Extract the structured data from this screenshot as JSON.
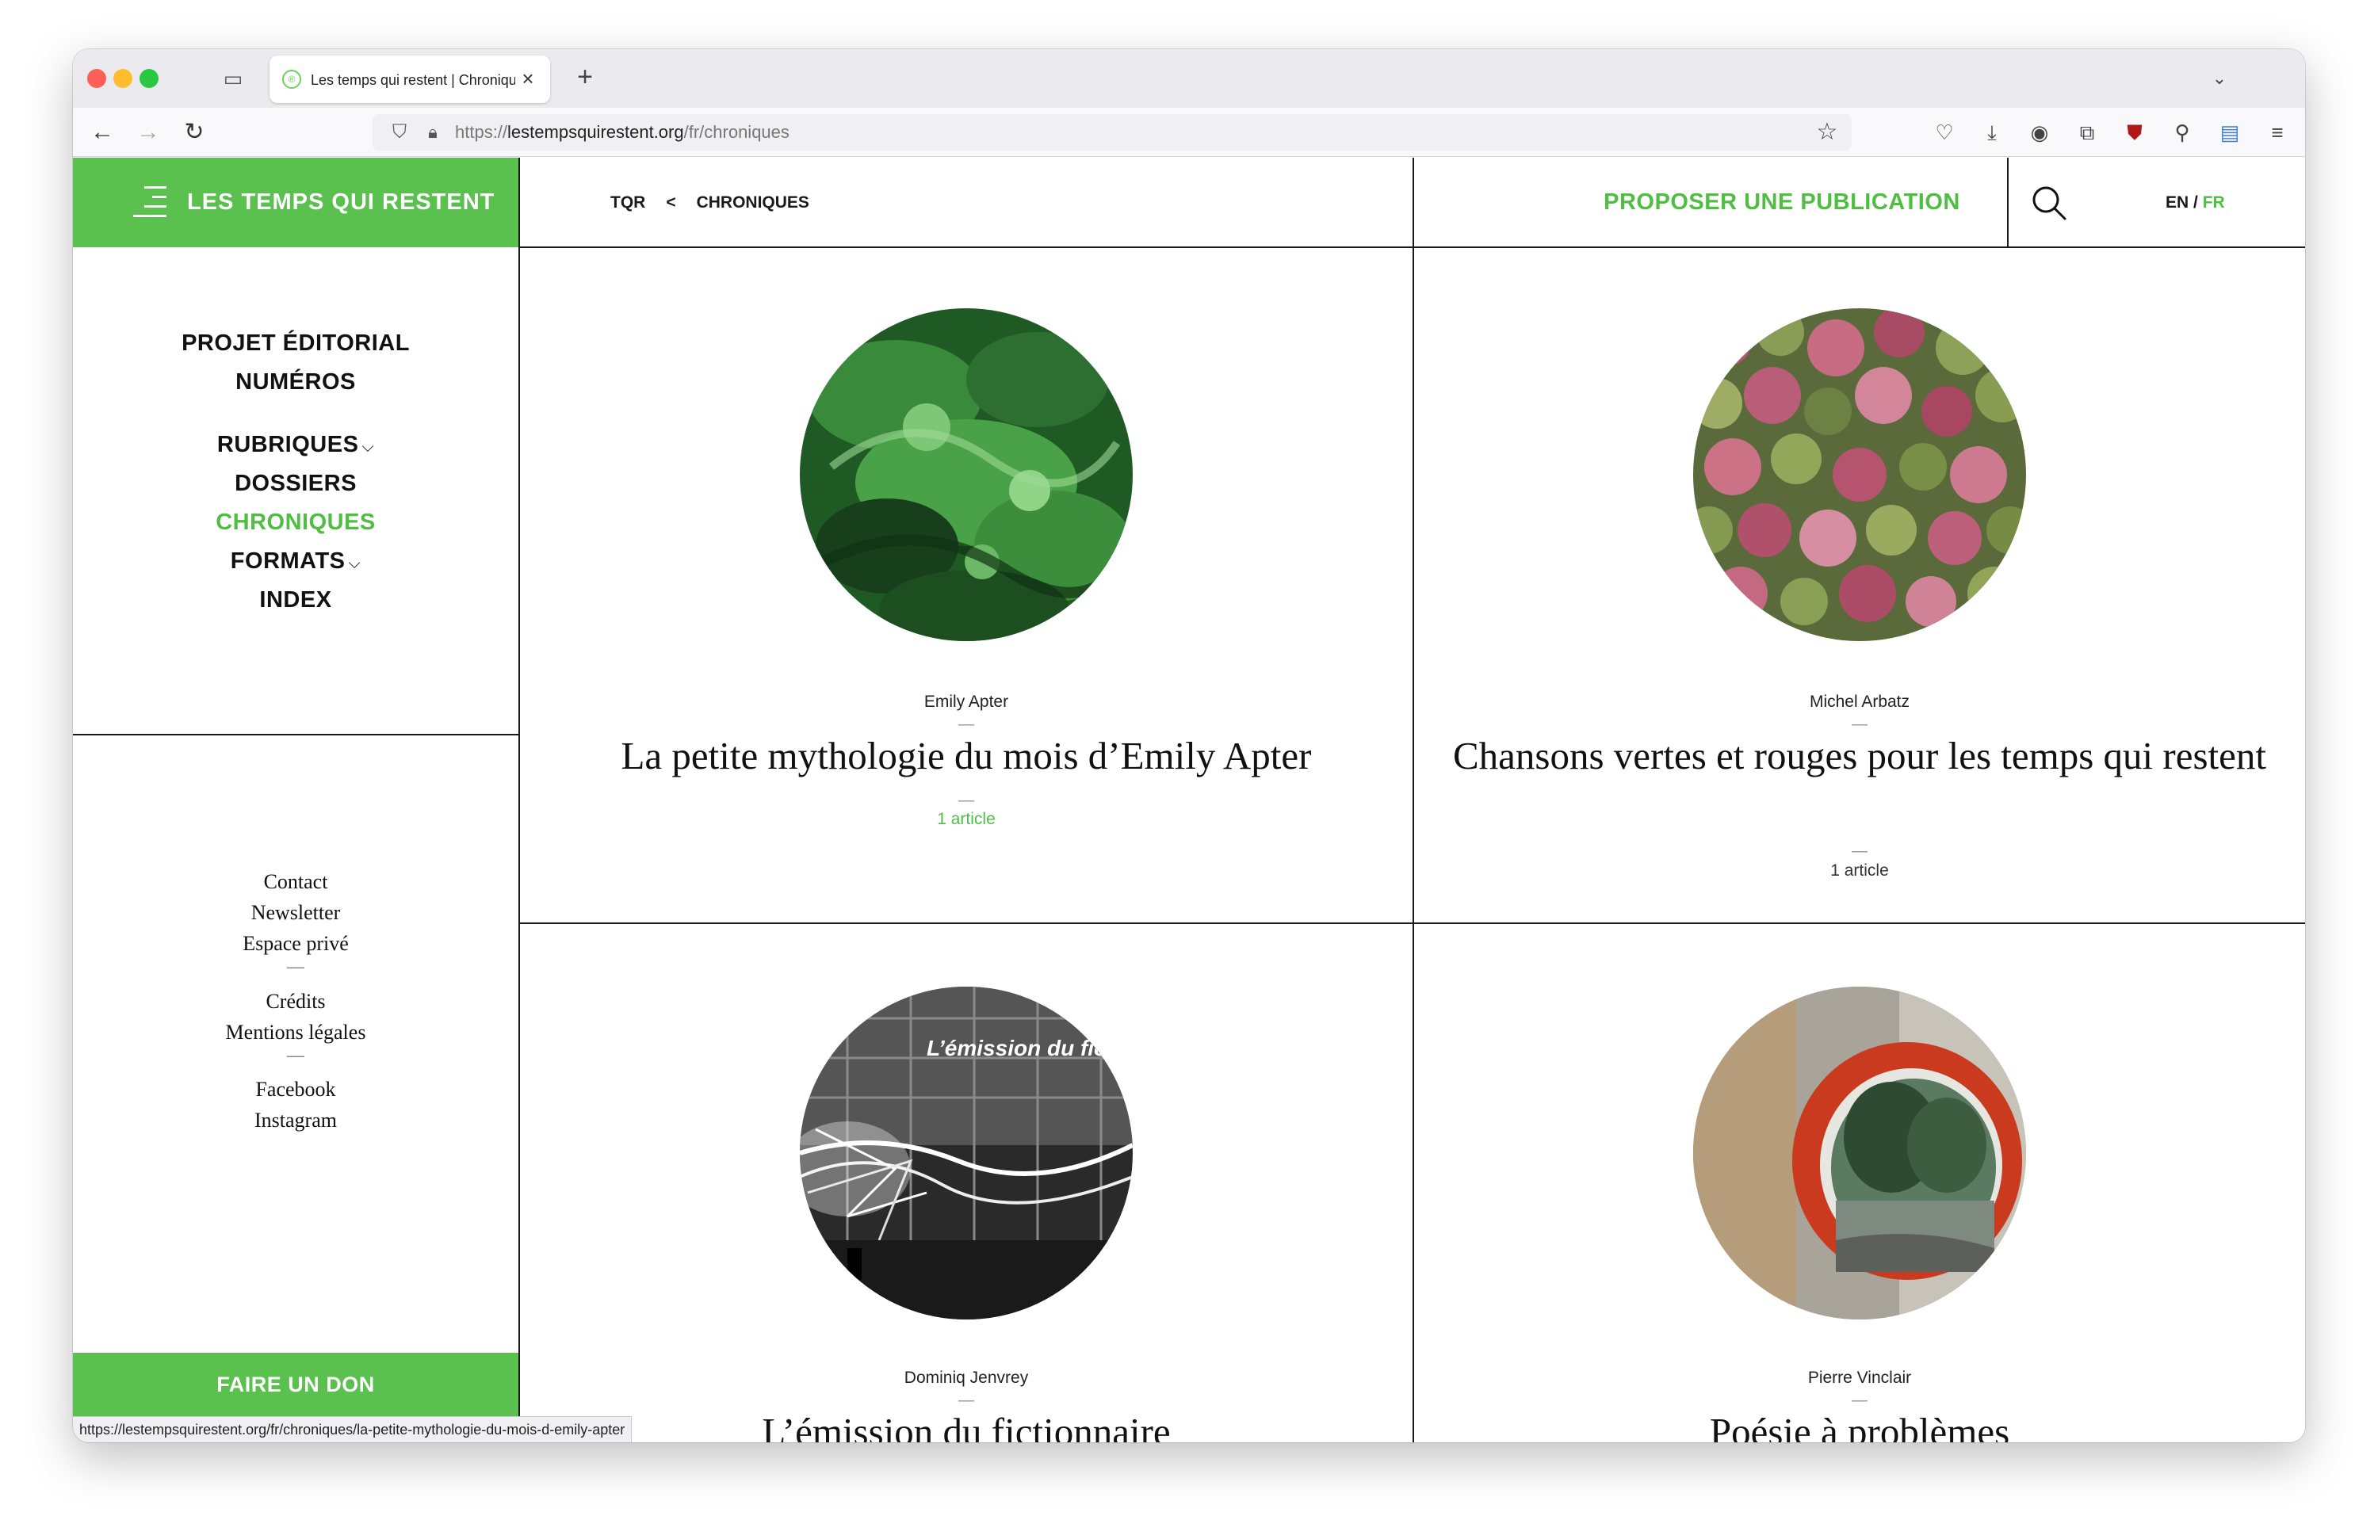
{
  "browser": {
    "tab_title": "Les temps qui restent | Chroniques",
    "url_prefix": "https://",
    "url_domain": "lestempsquirestent.org",
    "url_path": "/fr/chroniques",
    "status_url": "https://lestempsquirestent.org/fr/chroniques/la-petite-mythologie-du-mois-d-emily-apter"
  },
  "site": {
    "brand": "LES TEMPS QUI RESTENT",
    "breadcrumb_root": "TQR",
    "breadcrumb_sep": "<",
    "breadcrumb_current": "CHRONIQUES",
    "propose_label": "PROPOSER UNE PUBLICATION",
    "lang_en": "EN",
    "lang_sep": " / ",
    "lang_fr": "FR",
    "accent_color": "#5ac04e"
  },
  "nav": {
    "projet": "PROJET ÉDITORIAL",
    "numeros": "NUMÉROS",
    "rubriques": "RUBRIQUES",
    "dossiers": "DOSSIERS",
    "chroniques": "CHRONIQUES",
    "formats": "FORMATS",
    "index": "INDEX"
  },
  "footer": {
    "contact": "Contact",
    "newsletter": "Newsletter",
    "espace_prive": "Espace privé",
    "dash": "—",
    "credits": "Crédits",
    "mentions": "Mentions légales",
    "facebook": "Facebook",
    "instagram": "Instagram",
    "donate": "FAIRE UN DON"
  },
  "cards": [
    {
      "author": "Emily Apter",
      "dash": "—",
      "title": "La petite mythologie du mois d’Emily Apter",
      "count": "1 article"
    },
    {
      "author": "Michel Arbatz",
      "dash": "—",
      "title": "Chansons vertes et rouges pour les temps qui restent",
      "count": "1 article"
    },
    {
      "author": "Dominiq Jenvrey",
      "dash": "—",
      "title": "L’émission du fictionnaire",
      "image_caption": "L’émission du fict"
    },
    {
      "author": "Pierre Vinclair",
      "dash": "—",
      "title": "Poésie à problèmes"
    }
  ]
}
